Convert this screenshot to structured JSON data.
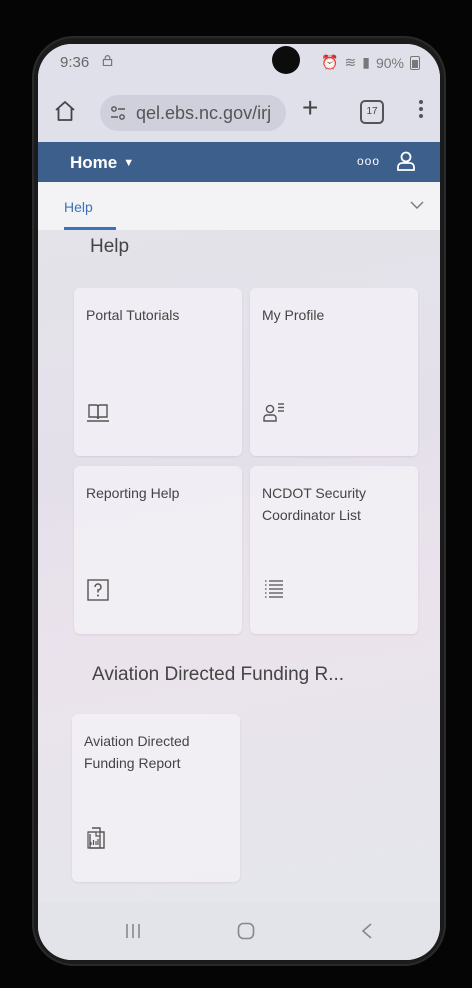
{
  "status": {
    "time": "9:36",
    "battery": "90%"
  },
  "browser": {
    "url": "qel.ebs.nc.gov/irj",
    "tab_count": "17"
  },
  "shell": {
    "home_label": "Home"
  },
  "tabs": {
    "active": "Help"
  },
  "sections": [
    {
      "title": "Help",
      "tiles": [
        {
          "title": "Portal Tutorials",
          "icon": "book-icon"
        },
        {
          "title": "My Profile",
          "icon": "profile-icon"
        },
        {
          "title": "Reporting Help",
          "icon": "question-icon"
        },
        {
          "title": "NCDOT Security Coordinator List",
          "icon": "list-icon"
        }
      ]
    },
    {
      "title": "Aviation Directed Funding R...",
      "tiles": [
        {
          "title": "Aviation Directed Funding Report",
          "icon": "report-icon"
        }
      ]
    }
  ]
}
